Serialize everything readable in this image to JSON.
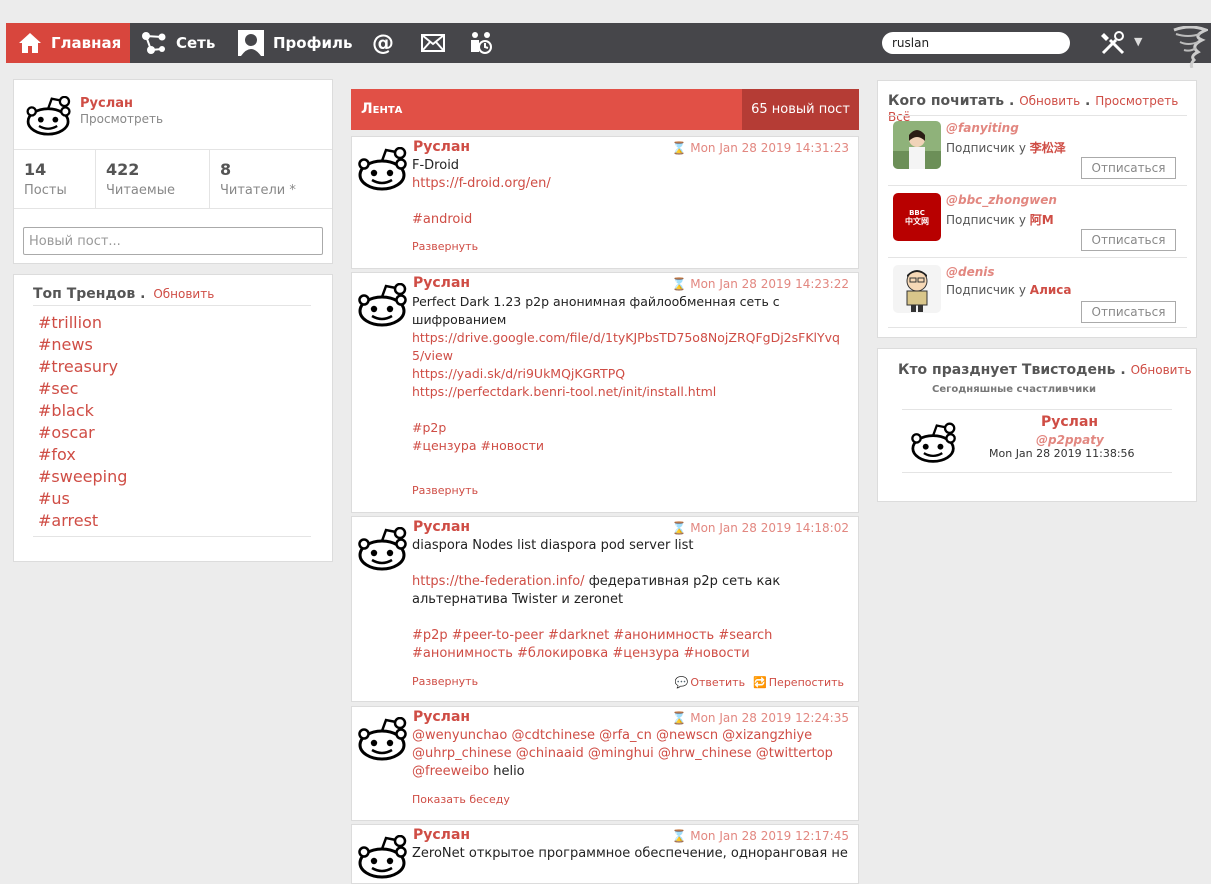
{
  "nav": {
    "home": "Главная",
    "network": "Сеть",
    "profile": "Профиль",
    "icons": [
      "mention-icon",
      "mail-icon",
      "groups-icon"
    ],
    "search_value": "ruslan"
  },
  "profile": {
    "name": "Руслан",
    "view_link": "Просмотреть",
    "stats": [
      {
        "num": "14",
        "label": "Посты"
      },
      {
        "num": "422",
        "label": "Читаемые"
      },
      {
        "num": "8",
        "label": "Читатели *"
      }
    ],
    "new_post_placeholder": "Новый пост..."
  },
  "trends": {
    "title": "Топ Трендов",
    "update": "Обновить",
    "items": [
      "#trillion",
      "#news",
      "#treasury",
      "#sec",
      "#black",
      "#oscar",
      "#fox",
      "#sweeping",
      "#us",
      "#arrest"
    ]
  },
  "feed": {
    "title": "Лента",
    "new_count": "65 новый пост",
    "posts": [
      {
        "author": "Руслан",
        "time": "Mon Jan 28 2019 14:31:23",
        "line1": "F-Droid",
        "link1": "https://f-droid.org/en/",
        "tags": "#android",
        "expand": "Развернуть"
      },
      {
        "author": "Руслан",
        "time": "Mon Jan 28 2019 14:23:22",
        "text": "Perfect Dark 1.23 p2p анонимная файлообменная сеть с шифрованием",
        "link1": "https://drive.google.com/file/d/1tyKJPbsTD75o8NojZRQFgDj2sFKlYvq5/view",
        "link2": "https://yadi.sk/d/ri9UkMQjKGRTPQ",
        "link3": "https://perfectdark.benri-tool.net/init/install.html",
        "tag1": "#p2p",
        "tag2": "#цензура #новости",
        "expand": "Развернуть"
      },
      {
        "author": "Руслан",
        "time": "Mon Jan 28 2019 14:18:02",
        "text": "diaspora Nodes list diaspora pod server list",
        "link": "https://the-federation.info/",
        "text2": " федеративная p2p сеть как альтернатива Twister и zeronet",
        "tags1": "#p2p #peer-to-peer #darknet #анонимность #search",
        "tags2": "#анонимность #блокировка #цензура #новости",
        "expand": "Развернуть",
        "reply": "Ответить",
        "repost": "Перепостить"
      },
      {
        "author": "Руслан",
        "time": "Mon Jan 28 2019 12:24:35",
        "mentions1": "@wenyunchao @cdtchinese @rfa_cn @newscn @xizangzhiye",
        "mentions2": "@uhrp_chinese @chinaaid @minghui @hrw_chinese @twittertop",
        "mentions3": "@freeweibo",
        "text": " helio",
        "show_thread": "Показать беседу"
      },
      {
        "author": "Руслан",
        "time": "Mon Jan 28 2019 12:17:45",
        "text": "ZeroNet открытое программное обеспечение, одноранговая не"
      }
    ]
  },
  "who_to_follow": {
    "title": "Кого почитать",
    "update": "Обновить",
    "view_all": "Просмотреть Всё",
    "followed_by": "Подписчик у",
    "unfollow": "Отписаться",
    "items": [
      {
        "handle": "@fanyiting",
        "by": "李松泽"
      },
      {
        "handle": "@bbc_zhongwen",
        "by": "阿M",
        "logo_text": "中文网",
        "logo_text_top": "BBC"
      },
      {
        "handle": "@denis",
        "by": "Алиса"
      }
    ]
  },
  "birthdays": {
    "title": "Кто празднует Твистодень",
    "update": "Обновить",
    "subtitle": "Сегодняшные счастливчики",
    "name": "Руслан",
    "handle": "@p2ppaty",
    "date": "Mon Jan 28 2019 11:38:56"
  },
  "colors": {
    "accent": "#d8463d",
    "accent_dark": "#b53c35",
    "nav_bg": "#46464a",
    "link": "#cf4d45"
  }
}
